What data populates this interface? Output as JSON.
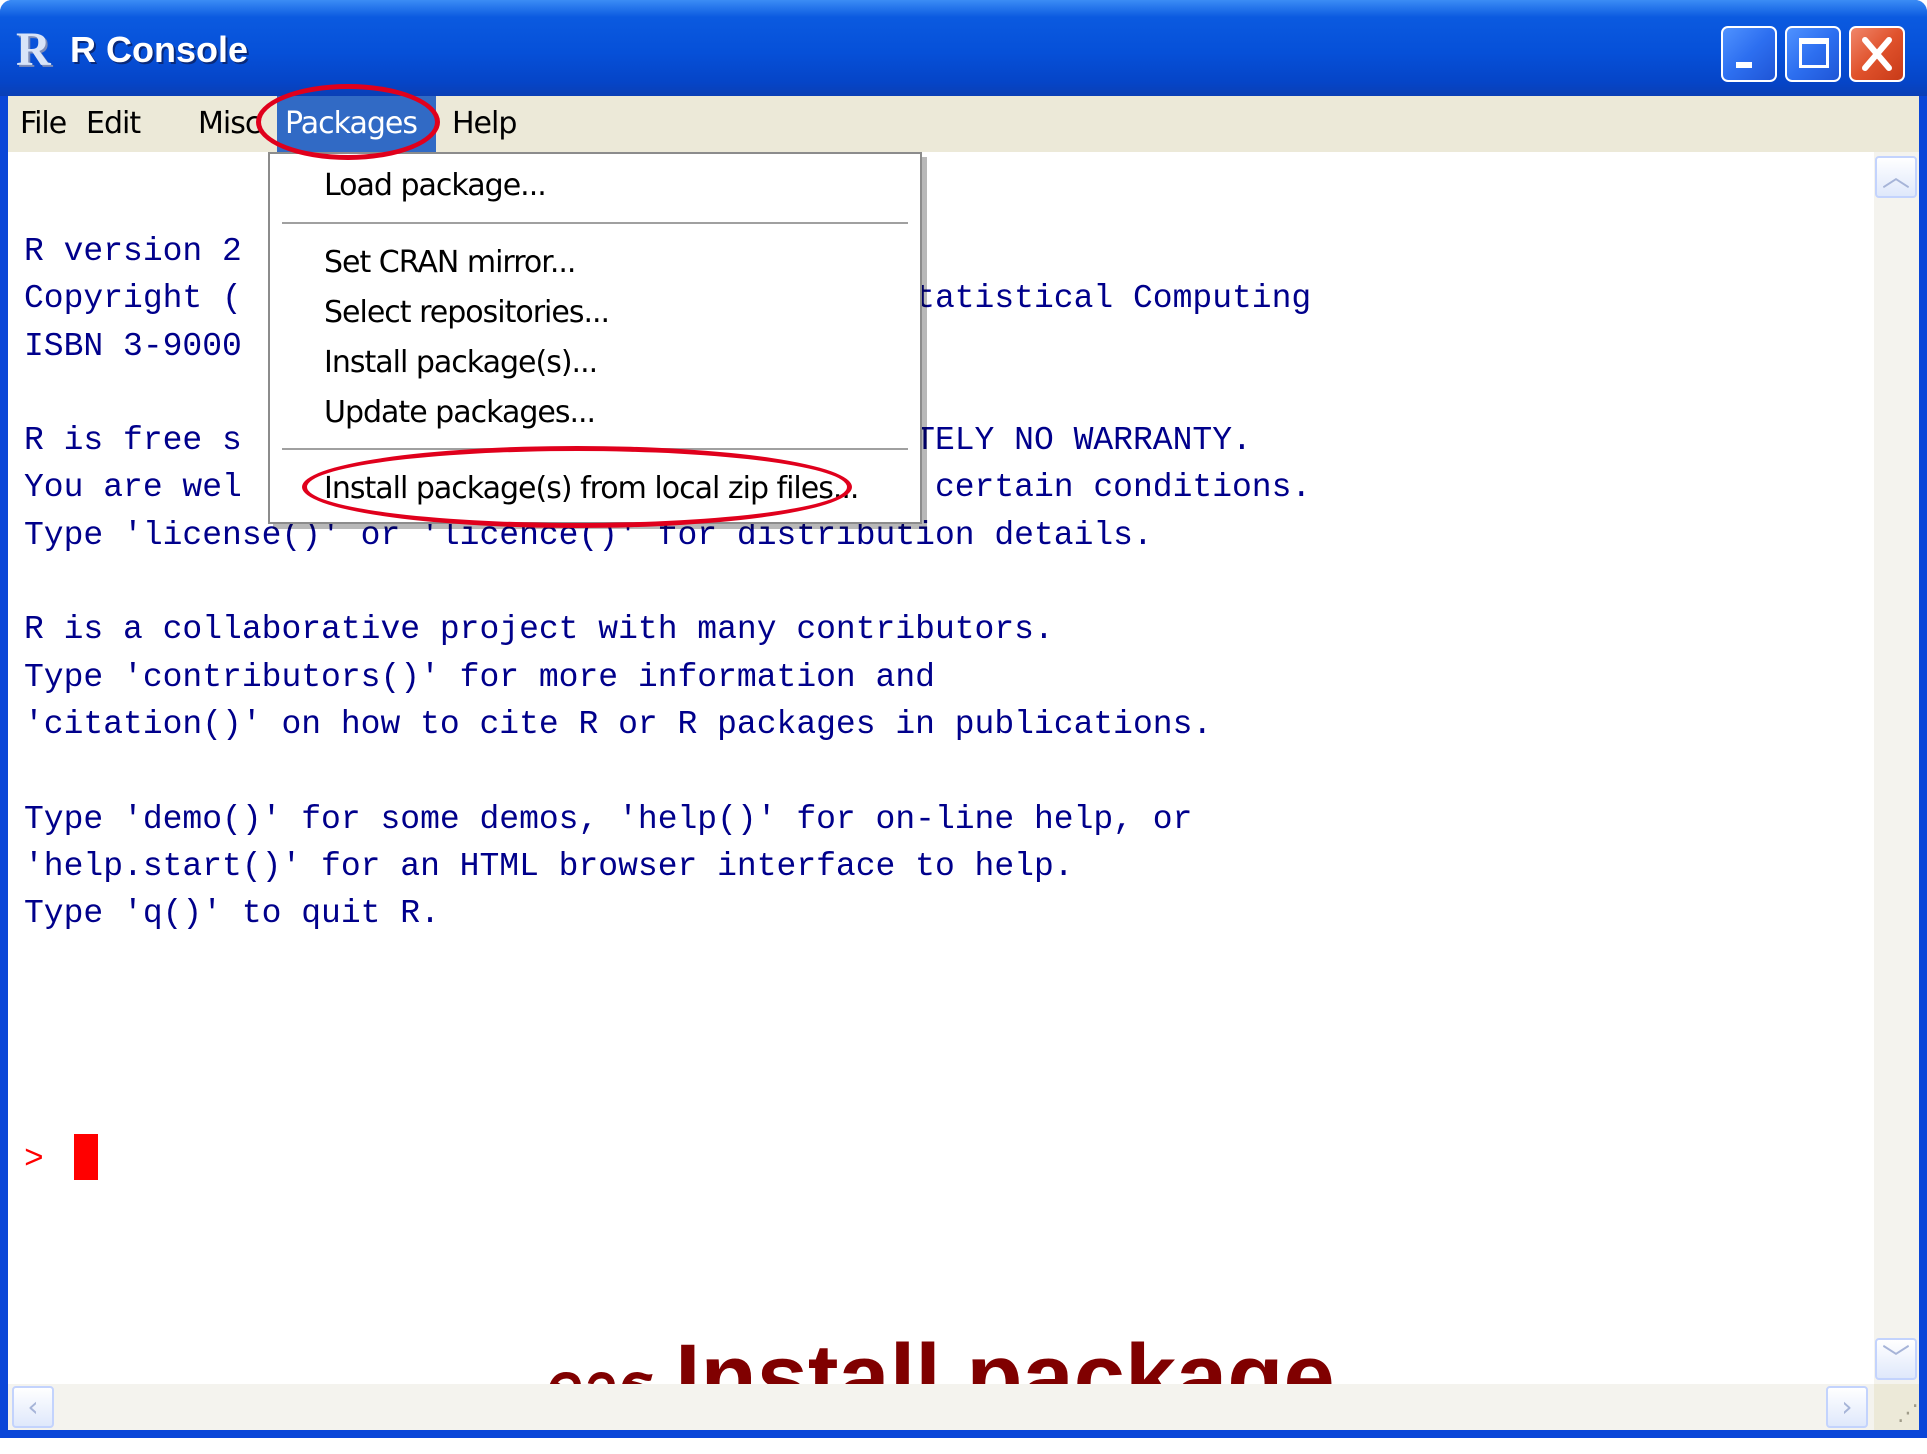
{
  "window": {
    "title": "R Console",
    "app_icon": "R"
  },
  "menubar": {
    "items": [
      "File",
      "Edit",
      "Misc",
      "Packages",
      "Help"
    ],
    "active": "Packages"
  },
  "packages_menu": {
    "items": [
      "Load package...",
      "Set CRAN mirror...",
      "Select repositories...",
      "Install package(s)...",
      "Update packages...",
      "Install package(s) from local zip files..."
    ]
  },
  "console": {
    "lines": [
      "R version 2",
      "Copyright (                                 Statistical Computing",
      "ISBN 3-9000",
      "",
      "R is free s                                 UTELY NO WARRANTY.",
      "You are wel                                 r certain conditions.",
      "Type 'license()' or 'licence()' for distribution details.",
      "",
      "R is a collaborative project with many contributors.",
      "Type 'contributors()' for more information and",
      "'citation()' on how to cite R or R packages in publications.",
      "",
      "Type 'demo()' for some demos, 'help()' for on-line help, or",
      "'help.start()' for an HTML browser interface to help.",
      "Type 'q()' to quit R."
    ],
    "prompt": ">"
  },
  "caption": {
    "thai": "การ",
    "main": "Install package"
  },
  "colors": {
    "console_text": "#00008b",
    "prompt": "#ff0000",
    "caption": "#800000",
    "annotation": "#e0001c",
    "menu_highlight": "#316ac5"
  },
  "icons": {
    "minimize": "minimize-icon",
    "maximize": "maximize-icon",
    "close": "close-icon",
    "scroll_up": "chevron-up-icon",
    "scroll_down": "chevron-down-icon",
    "scroll_left": "chevron-left-icon",
    "scroll_right": "chevron-right-icon"
  }
}
